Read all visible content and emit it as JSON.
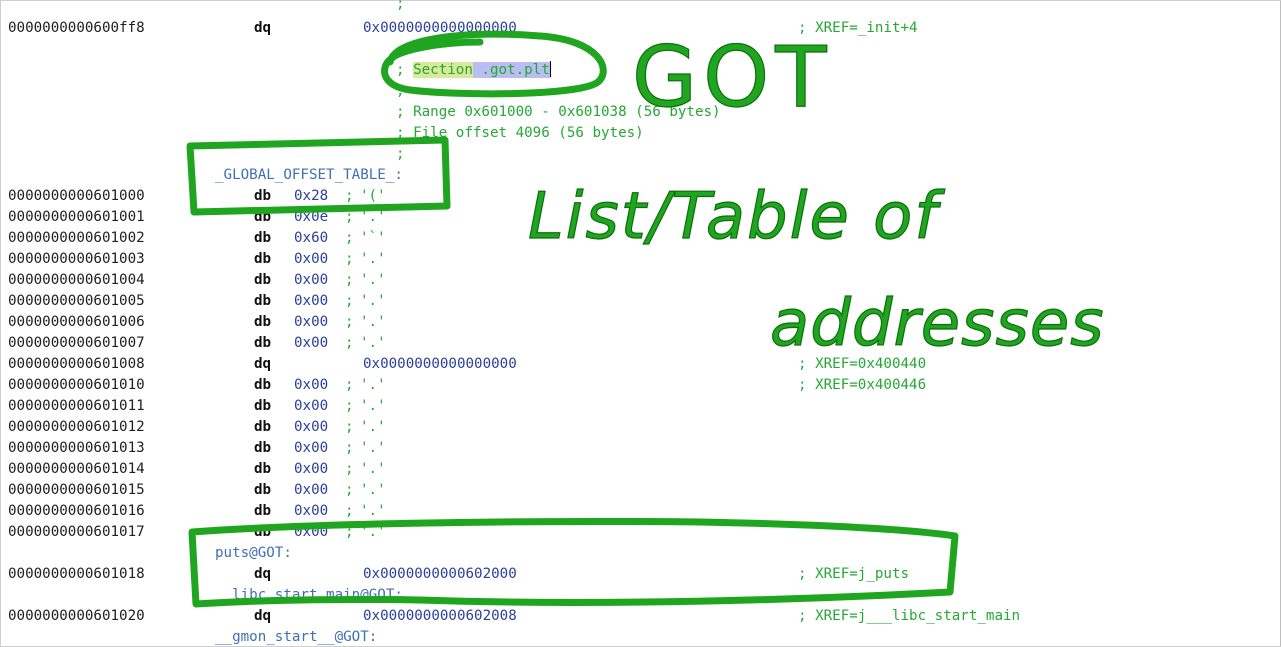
{
  "top_semicolon": ";",
  "first_row": {
    "addr": "0000000000600ff8",
    "mnemonic": "dq",
    "operand": "0x0000000000000000",
    "comment": "; XREF=_init+4"
  },
  "section_header": {
    "semi": ";",
    "section_word": "Section",
    "section_name": " .got.plt",
    "blank1": ";",
    "range": "; Range 0x601000 - 0x601038 (56 bytes)",
    "file_offset": "; File offset 4096 (56 bytes)",
    "blank2": ";"
  },
  "got_label": "_GLOBAL_OFFSET_TABLE_:",
  "byte_rows": [
    {
      "addr": "0000000000601000",
      "mnemonic": "db",
      "operand": "0x28",
      "comment": ";",
      "char": "'('"
    },
    {
      "addr": "0000000000601001",
      "mnemonic": "db",
      "operand": "0x0e",
      "comment": ";",
      "char": "'.'"
    },
    {
      "addr": "0000000000601002",
      "mnemonic": "db",
      "operand": "0x60",
      "comment": ";",
      "char": "'`'"
    },
    {
      "addr": "0000000000601003",
      "mnemonic": "db",
      "operand": "0x00",
      "comment": ";",
      "char": "'.'"
    },
    {
      "addr": "0000000000601004",
      "mnemonic": "db",
      "operand": "0x00",
      "comment": ";",
      "char": "'.'"
    },
    {
      "addr": "0000000000601005",
      "mnemonic": "db",
      "operand": "0x00",
      "comment": ";",
      "char": "'.'"
    },
    {
      "addr": "0000000000601006",
      "mnemonic": "db",
      "operand": "0x00",
      "comment": ";",
      "char": "'.'"
    },
    {
      "addr": "0000000000601007",
      "mnemonic": "db",
      "operand": "0x00",
      "comment": ";",
      "char": "'.'"
    }
  ],
  "qword_row_1": {
    "addr": "0000000000601008",
    "mnemonic": "dq",
    "operand": "0x0000000000000000",
    "comment": "; XREF=0x400440"
  },
  "byte_rows_2": [
    {
      "addr": "0000000000601010",
      "mnemonic": "db",
      "operand": "0x00",
      "comment": ";",
      "char": "'.'",
      "xref": "; XREF=0x400446"
    },
    {
      "addr": "0000000000601011",
      "mnemonic": "db",
      "operand": "0x00",
      "comment": ";",
      "char": "'.'",
      "xref": ""
    },
    {
      "addr": "0000000000601012",
      "mnemonic": "db",
      "operand": "0x00",
      "comment": ";",
      "char": "'.'",
      "xref": ""
    },
    {
      "addr": "0000000000601013",
      "mnemonic": "db",
      "operand": "0x00",
      "comment": ";",
      "char": "'.'",
      "xref": ""
    },
    {
      "addr": "0000000000601014",
      "mnemonic": "db",
      "operand": "0x00",
      "comment": ";",
      "char": "'.'",
      "xref": ""
    },
    {
      "addr": "0000000000601015",
      "mnemonic": "db",
      "operand": "0x00",
      "comment": ";",
      "char": "'.'",
      "xref": ""
    },
    {
      "addr": "0000000000601016",
      "mnemonic": "db",
      "operand": "0x00",
      "comment": ";",
      "char": "'.'",
      "xref": ""
    },
    {
      "addr": "0000000000601017",
      "mnemonic": "db",
      "operand": "0x00",
      "comment": ";",
      "char": "'.'",
      "xref": ""
    }
  ],
  "puts_label": "puts@GOT:",
  "puts_row": {
    "addr": "0000000000601018",
    "mnemonic": "dq",
    "operand": "0x0000000000602000",
    "comment": "; XREF=j_puts"
  },
  "libc_label": "__libc_start_main@GOT:",
  "libc_row": {
    "addr": "0000000000601020",
    "mnemonic": "dq",
    "operand": "0x0000000000602008",
    "comment": "; XREF=j___libc_start_main"
  },
  "gmon_label": "__gmon_start__@GOT:",
  "annotations": {
    "title": "GOT",
    "line1": "List/Table of",
    "line2": "addresses",
    "ink_color": "#1fa51f"
  }
}
